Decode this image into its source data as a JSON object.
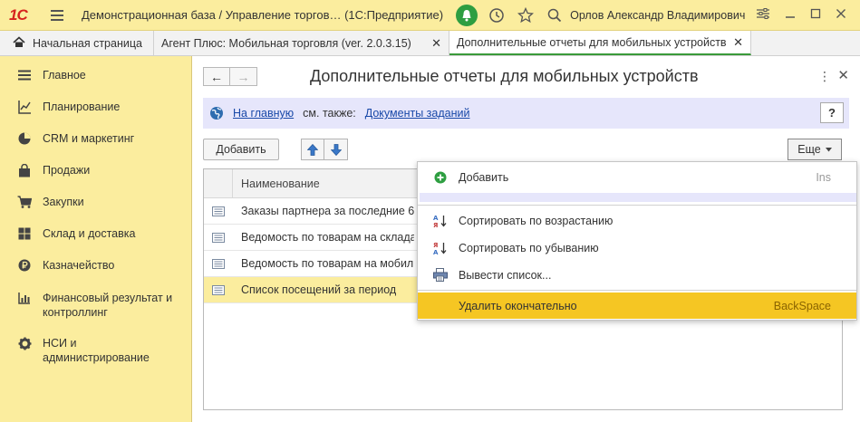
{
  "titlebar": {
    "logo": "1С",
    "title": "Демонстрационная база / Управление торгов…  (1С:Предприятие)",
    "user": "Орлов Александр Владимирович"
  },
  "tabs": {
    "home": "Начальная страница",
    "tab2": "Агент Плюс: Мобильная торговля (ver. 2.0.3.15)",
    "tab3": "Дополнительные отчеты для мобильных устройств",
    "close_glyph": "✕"
  },
  "sidebar": {
    "items": [
      {
        "label": "Главное",
        "icon": "menu-lines-icon"
      },
      {
        "label": "Планирование",
        "icon": "planning-icon"
      },
      {
        "label": "CRM и маркетинг",
        "icon": "pie-chart-icon"
      },
      {
        "label": "Продажи",
        "icon": "shopping-bag-icon"
      },
      {
        "label": "Закупки",
        "icon": "cart-icon"
      },
      {
        "label": "Склад и доставка",
        "icon": "warehouse-icon"
      },
      {
        "label": "Казначейство",
        "icon": "ruble-coin-icon"
      },
      {
        "label": "Финансовый результат и контроллинг",
        "icon": "bar-chart-icon"
      },
      {
        "label": "НСИ и администрирование",
        "icon": "gear-icon"
      }
    ]
  },
  "form": {
    "back": "←",
    "forward": "→",
    "title": "Дополнительные отчеты для мобильных устройств",
    "menu": "⋮",
    "close": "✕"
  },
  "infobar": {
    "home_link": "На главную",
    "see_also": "см. также:",
    "tasks_link": "Документы заданий",
    "help": "?"
  },
  "toolbar": {
    "add": "Добавить",
    "more": "Еще"
  },
  "table": {
    "header": "Наименование",
    "rows": [
      {
        "name": "Заказы партнера за последние 6 месяцев",
        "selected": false
      },
      {
        "name": "Ведомость по товарам на складах",
        "selected": false
      },
      {
        "name": "Ведомость по товарам на мобильном складе",
        "selected": false
      },
      {
        "name": "Список посещений за период",
        "selected": true
      }
    ]
  },
  "popup": {
    "items": [
      {
        "label": "Добавить",
        "shortcut": "Ins"
      },
      {
        "label": "Сортировать по возрастанию",
        "shortcut": ""
      },
      {
        "label": "Сортировать по убыванию",
        "shortcut": ""
      },
      {
        "label": "Вывести список...",
        "shortcut": ""
      },
      {
        "label": "Удалить окончательно",
        "shortcut": "BackSpace"
      }
    ]
  },
  "colors": {
    "accent_yellow": "#fbed9e",
    "highlight": "#f5c623",
    "link_blue": "#1848a8",
    "green": "#2e9e41"
  }
}
